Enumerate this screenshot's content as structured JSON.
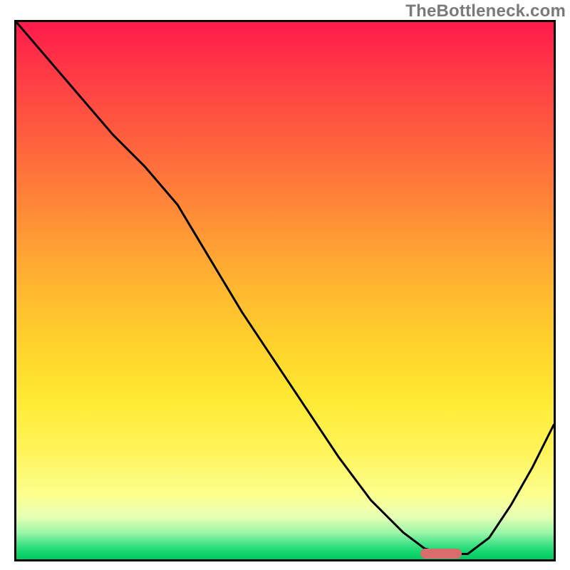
{
  "watermark": "TheBottleneck.com",
  "chart_data": {
    "type": "line",
    "title": "",
    "xlabel": "",
    "ylabel": "",
    "xlim": [
      0,
      100
    ],
    "ylim": [
      0,
      100
    ],
    "grid": false,
    "series": [
      {
        "name": "curve",
        "x": [
          0,
          6,
          12,
          18,
          24,
          30,
          36,
          42,
          48,
          54,
          60,
          66,
          72,
          76,
          80,
          84,
          88,
          92,
          96,
          100
        ],
        "y": [
          100,
          93,
          86,
          79,
          73,
          66,
          56,
          46,
          37,
          28,
          19,
          11,
          5,
          2,
          1,
          1,
          4,
          10,
          17,
          25
        ]
      }
    ],
    "annotations": [
      {
        "name": "valley-marker",
        "x": 79,
        "y": 1
      }
    ],
    "background_gradient": {
      "stops": [
        {
          "pos": 0,
          "color": "#ff1a4b"
        },
        {
          "pos": 0.5,
          "color": "#ffd22c"
        },
        {
          "pos": 0.88,
          "color": "#fbff8f"
        },
        {
          "pos": 1.0,
          "color": "#00c95f"
        }
      ]
    }
  },
  "marker_style": {
    "left_pct": 79,
    "top_pct": 99
  }
}
